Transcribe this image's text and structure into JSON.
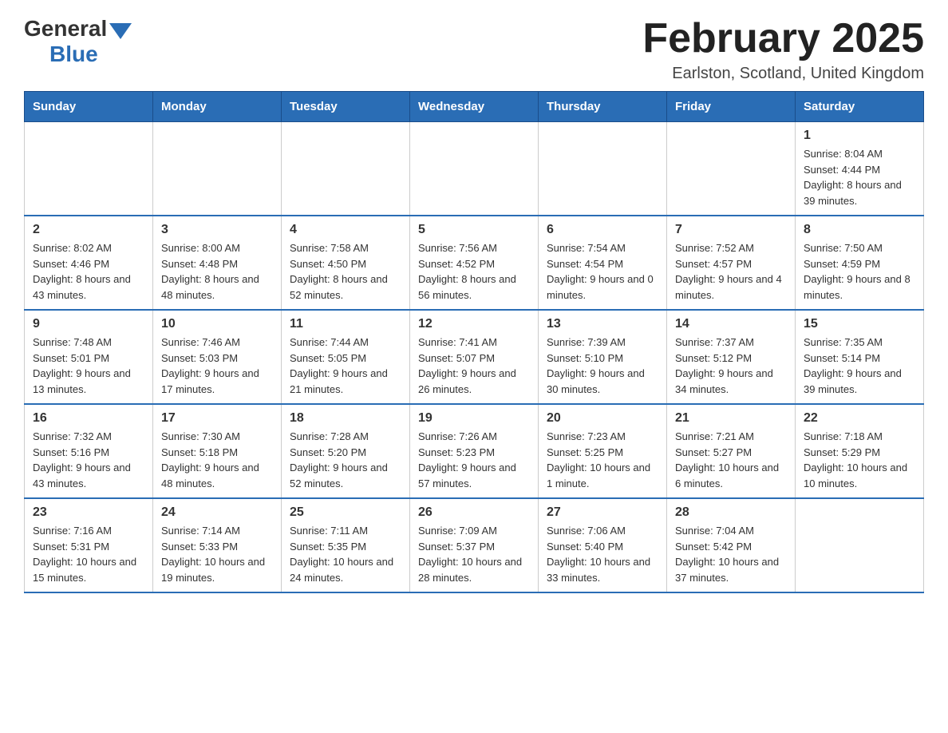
{
  "header": {
    "logo": {
      "text_general": "General",
      "text_blue": "Blue"
    },
    "title": "February 2025",
    "location": "Earlston, Scotland, United Kingdom"
  },
  "weekdays": [
    "Sunday",
    "Monday",
    "Tuesday",
    "Wednesday",
    "Thursday",
    "Friday",
    "Saturday"
  ],
  "weeks": [
    [
      {
        "day": "",
        "info": ""
      },
      {
        "day": "",
        "info": ""
      },
      {
        "day": "",
        "info": ""
      },
      {
        "day": "",
        "info": ""
      },
      {
        "day": "",
        "info": ""
      },
      {
        "day": "",
        "info": ""
      },
      {
        "day": "1",
        "info": "Sunrise: 8:04 AM\nSunset: 4:44 PM\nDaylight: 8 hours and 39 minutes."
      }
    ],
    [
      {
        "day": "2",
        "info": "Sunrise: 8:02 AM\nSunset: 4:46 PM\nDaylight: 8 hours and 43 minutes."
      },
      {
        "day": "3",
        "info": "Sunrise: 8:00 AM\nSunset: 4:48 PM\nDaylight: 8 hours and 48 minutes."
      },
      {
        "day": "4",
        "info": "Sunrise: 7:58 AM\nSunset: 4:50 PM\nDaylight: 8 hours and 52 minutes."
      },
      {
        "day": "5",
        "info": "Sunrise: 7:56 AM\nSunset: 4:52 PM\nDaylight: 8 hours and 56 minutes."
      },
      {
        "day": "6",
        "info": "Sunrise: 7:54 AM\nSunset: 4:54 PM\nDaylight: 9 hours and 0 minutes."
      },
      {
        "day": "7",
        "info": "Sunrise: 7:52 AM\nSunset: 4:57 PM\nDaylight: 9 hours and 4 minutes."
      },
      {
        "day": "8",
        "info": "Sunrise: 7:50 AM\nSunset: 4:59 PM\nDaylight: 9 hours and 8 minutes."
      }
    ],
    [
      {
        "day": "9",
        "info": "Sunrise: 7:48 AM\nSunset: 5:01 PM\nDaylight: 9 hours and 13 minutes."
      },
      {
        "day": "10",
        "info": "Sunrise: 7:46 AM\nSunset: 5:03 PM\nDaylight: 9 hours and 17 minutes."
      },
      {
        "day": "11",
        "info": "Sunrise: 7:44 AM\nSunset: 5:05 PM\nDaylight: 9 hours and 21 minutes."
      },
      {
        "day": "12",
        "info": "Sunrise: 7:41 AM\nSunset: 5:07 PM\nDaylight: 9 hours and 26 minutes."
      },
      {
        "day": "13",
        "info": "Sunrise: 7:39 AM\nSunset: 5:10 PM\nDaylight: 9 hours and 30 minutes."
      },
      {
        "day": "14",
        "info": "Sunrise: 7:37 AM\nSunset: 5:12 PM\nDaylight: 9 hours and 34 minutes."
      },
      {
        "day": "15",
        "info": "Sunrise: 7:35 AM\nSunset: 5:14 PM\nDaylight: 9 hours and 39 minutes."
      }
    ],
    [
      {
        "day": "16",
        "info": "Sunrise: 7:32 AM\nSunset: 5:16 PM\nDaylight: 9 hours and 43 minutes."
      },
      {
        "day": "17",
        "info": "Sunrise: 7:30 AM\nSunset: 5:18 PM\nDaylight: 9 hours and 48 minutes."
      },
      {
        "day": "18",
        "info": "Sunrise: 7:28 AM\nSunset: 5:20 PM\nDaylight: 9 hours and 52 minutes."
      },
      {
        "day": "19",
        "info": "Sunrise: 7:26 AM\nSunset: 5:23 PM\nDaylight: 9 hours and 57 minutes."
      },
      {
        "day": "20",
        "info": "Sunrise: 7:23 AM\nSunset: 5:25 PM\nDaylight: 10 hours and 1 minute."
      },
      {
        "day": "21",
        "info": "Sunrise: 7:21 AM\nSunset: 5:27 PM\nDaylight: 10 hours and 6 minutes."
      },
      {
        "day": "22",
        "info": "Sunrise: 7:18 AM\nSunset: 5:29 PM\nDaylight: 10 hours and 10 minutes."
      }
    ],
    [
      {
        "day": "23",
        "info": "Sunrise: 7:16 AM\nSunset: 5:31 PM\nDaylight: 10 hours and 15 minutes."
      },
      {
        "day": "24",
        "info": "Sunrise: 7:14 AM\nSunset: 5:33 PM\nDaylight: 10 hours and 19 minutes."
      },
      {
        "day": "25",
        "info": "Sunrise: 7:11 AM\nSunset: 5:35 PM\nDaylight: 10 hours and 24 minutes."
      },
      {
        "day": "26",
        "info": "Sunrise: 7:09 AM\nSunset: 5:37 PM\nDaylight: 10 hours and 28 minutes."
      },
      {
        "day": "27",
        "info": "Sunrise: 7:06 AM\nSunset: 5:40 PM\nDaylight: 10 hours and 33 minutes."
      },
      {
        "day": "28",
        "info": "Sunrise: 7:04 AM\nSunset: 5:42 PM\nDaylight: 10 hours and 37 minutes."
      },
      {
        "day": "",
        "info": ""
      }
    ]
  ]
}
